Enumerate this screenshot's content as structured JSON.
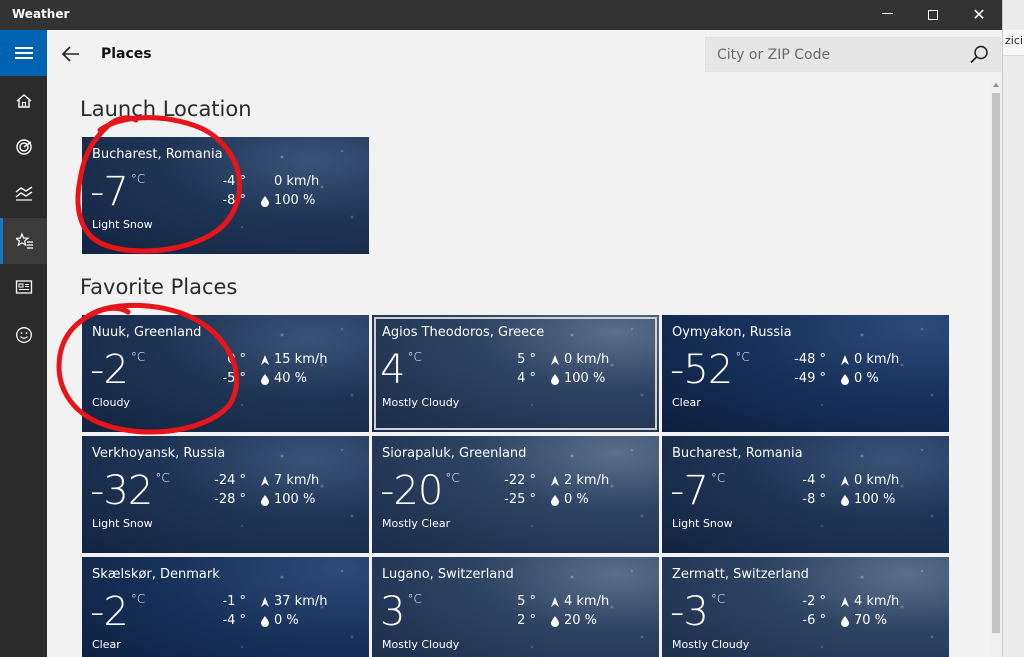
{
  "window": {
    "title": "Weather"
  },
  "background_window": {
    "fragment": "zici"
  },
  "header": {
    "title": "Places",
    "search": {
      "placeholder": "City or ZIP Code",
      "value": ""
    }
  },
  "nav": [
    "menu-icon",
    "home-icon",
    "forecast-icon",
    "historical-icon",
    "places-icon",
    "news-icon",
    "feedback-icon"
  ],
  "sections": {
    "launch": "Launch Location",
    "favorites": "Favorite Places"
  },
  "launch_tile": {
    "name": "Bucharest, Romania",
    "temp": "-7",
    "unit": "°C",
    "hi": "-4 °",
    "lo": "-8 °",
    "wind": "0 km/h",
    "humidity": "100 %",
    "condition": "Light Snow"
  },
  "tiles": [
    {
      "name": "Nuuk, Greenland",
      "temp": "-2",
      "unit": "°C",
      "hi": "0 °",
      "lo": "-5 °",
      "wind": "15 km/h",
      "humidity": "40 %",
      "condition": "Cloudy"
    },
    {
      "name": "Agios Theodoros, Greece",
      "temp": "4",
      "unit": "°C",
      "hi": "5 °",
      "lo": "4 °",
      "wind": "0 km/h",
      "humidity": "100 %",
      "condition": "Mostly Cloudy"
    },
    {
      "name": "Oymyakon, Russia",
      "temp": "-52",
      "unit": "°C",
      "hi": "-48 °",
      "lo": "-49 °",
      "wind": "0 km/h",
      "humidity": "0 %",
      "condition": "Clear"
    },
    {
      "name": "Verkhoyansk, Russia",
      "temp": "-32",
      "unit": "°C",
      "hi": "-24 °",
      "lo": "-28 °",
      "wind": "7 km/h",
      "humidity": "100 %",
      "condition": "Light Snow"
    },
    {
      "name": "Siorapaluk, Greenland",
      "temp": "-20",
      "unit": "°C",
      "hi": "-22 °",
      "lo": "-25 °",
      "wind": "2 km/h",
      "humidity": "0 %",
      "condition": "Mostly Clear"
    },
    {
      "name": "Bucharest, Romania",
      "temp": "-7",
      "unit": "°C",
      "hi": "-4 °",
      "lo": "-8 °",
      "wind": "0 km/h",
      "humidity": "100 %",
      "condition": "Light Snow"
    },
    {
      "name": "Skælskør, Denmark",
      "temp": "-2",
      "unit": "°C",
      "hi": "-1 °",
      "lo": "-4 °",
      "wind": "37 km/h",
      "humidity": "0 %",
      "condition": "Clear"
    },
    {
      "name": "Lugano, Switzerland",
      "temp": "3",
      "unit": "°C",
      "hi": "5 °",
      "lo": "2 °",
      "wind": "4 km/h",
      "humidity": "20 %",
      "condition": "Mostly Cloudy"
    },
    {
      "name": "Zermatt, Switzerland",
      "temp": "-3",
      "unit": "°C",
      "hi": "-2 °",
      "lo": "-6 °",
      "wind": "4 km/h",
      "humidity": "70 %",
      "condition": "Mostly Cloudy"
    }
  ],
  "colors": {
    "accent": "#0063b1",
    "annotation": "#e8141a",
    "nav_bg": "#2b2b2b"
  }
}
